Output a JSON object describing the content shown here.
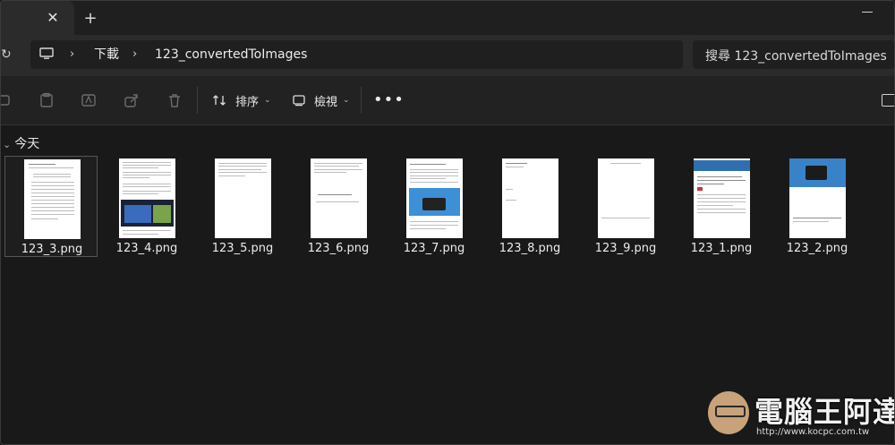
{
  "window": {
    "tab_close_glyph": "✕",
    "new_tab_glyph": "+"
  },
  "address_bar": {
    "refresh_glyph": "↻",
    "breadcrumb_sep": "›",
    "crumbs": [
      "下載",
      "123_convertedToImages"
    ]
  },
  "search": {
    "placeholder": "搜尋 123_convertedToImages"
  },
  "toolbar": {
    "icons": [
      "rename-icon",
      "paste-icon",
      "rename-text-icon",
      "share-icon",
      "delete-icon"
    ],
    "sort_label": "排序",
    "view_label": "檢視",
    "caret": "⌄",
    "more_label": "•••"
  },
  "group": {
    "chevron": "⌄",
    "label": "今天"
  },
  "files": [
    {
      "name": "123_3.png",
      "selected": true
    },
    {
      "name": "123_4.png",
      "selected": false
    },
    {
      "name": "123_5.png",
      "selected": false
    },
    {
      "name": "123_6.png",
      "selected": false
    },
    {
      "name": "123_7.png",
      "selected": false
    },
    {
      "name": "123_8.png",
      "selected": false
    },
    {
      "name": "123_9.png",
      "selected": false
    },
    {
      "name": "123_1.png",
      "selected": false
    },
    {
      "name": "123_2.png",
      "selected": false
    }
  ],
  "watermark": {
    "text": "電腦王阿達",
    "url": "http://www.kocpc.com.tw"
  },
  "colors": {
    "background": "#191919",
    "toolbar": "#222222",
    "address_row": "#2b2b2b",
    "thumb_accent_blue": "#2f6fb0"
  }
}
